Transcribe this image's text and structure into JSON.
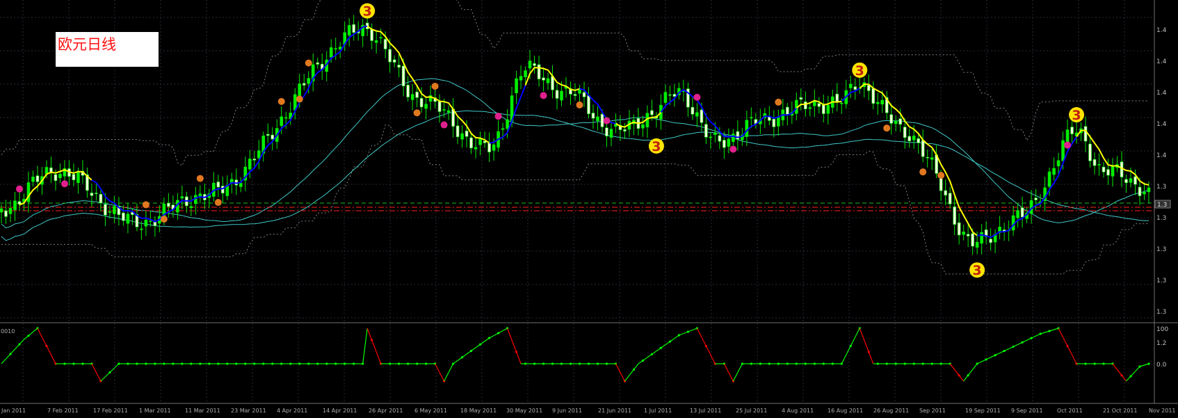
{
  "app_title": "欧元日线",
  "chart_data": {
    "type": "candlestick",
    "title": "欧元日线",
    "x_tick_labels": [
      "Jan 2011",
      "7 Feb 2011",
      "17 Feb 2011",
      "1 Mar 2011",
      "11 Mar 2011",
      "23 Mar 2011",
      "4 Apr 2011",
      "14 Apr 2011",
      "26 Apr 2011",
      "6 May 2011",
      "18 May 2011",
      "30 May 2011",
      "9 Jun 2011",
      "21 Jun 2011",
      "1 Jul 2011",
      "13 Jul 2011",
      "25 Jul 2011",
      "4 Aug 2011",
      "16 Aug 2011",
      "26 Aug 2011",
      "Sep 2011",
      "19 Sep 2011",
      "9 Sep 2011",
      "Oct 2011",
      "21 Oct 2011",
      "Nov 2011"
    ],
    "price_axis_labels": [
      "1.4",
      "1.4",
      "1.4",
      "1.4",
      "1.4",
      "1.3",
      "1.3",
      "1.3",
      "1.3",
      "1.3",
      "1.2"
    ],
    "current_price_label": "1.3",
    "indicator_axis_labels": [
      "100",
      "0.0"
    ],
    "indicator_left_label": "0010",
    "markers": [
      {
        "label": "3",
        "kind": "peak",
        "x_index": 81
      },
      {
        "label": "3",
        "kind": "trough",
        "x_index": 145
      },
      {
        "label": "3",
        "kind": "peak",
        "x_index": 190
      },
      {
        "label": "3",
        "kind": "trough",
        "x_index": 216
      },
      {
        "label": "3",
        "kind": "peak",
        "x_index": 238
      }
    ],
    "colors": {
      "background": "#000000",
      "bull_candle": "#00ee00",
      "bear_candle": "#f0ffd8",
      "ma_down": "#ffff00",
      "ma_up": "#0000ff",
      "bands": "#40c8c8",
      "envelope": "#808080",
      "level_red": "#ff2020",
      "level_green": "#20c020",
      "osc_up": "#00ff00",
      "osc_down": "#ff0000",
      "marker_yellow": "#ffe400",
      "marker_pink": "#e0208c",
      "marker_orange": "#e07820"
    }
  }
}
